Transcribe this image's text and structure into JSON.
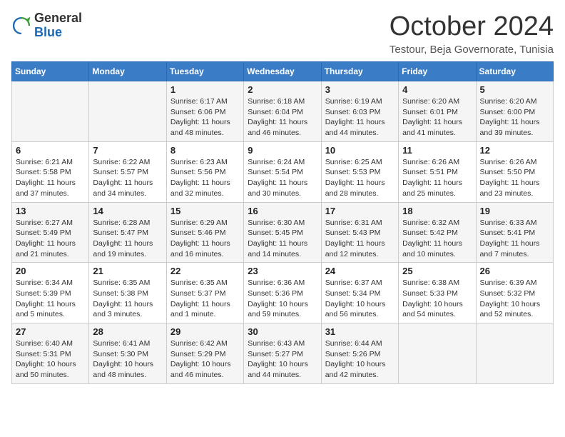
{
  "logo": {
    "general": "General",
    "blue": "Blue"
  },
  "header": {
    "month": "October 2024",
    "location": "Testour, Beja Governorate, Tunisia"
  },
  "weekdays": [
    "Sunday",
    "Monday",
    "Tuesday",
    "Wednesday",
    "Thursday",
    "Friday",
    "Saturday"
  ],
  "weeks": [
    [
      {
        "day": "",
        "info": ""
      },
      {
        "day": "",
        "info": ""
      },
      {
        "day": "1",
        "info": "Sunrise: 6:17 AM\nSunset: 6:06 PM\nDaylight: 11 hours and 48 minutes."
      },
      {
        "day": "2",
        "info": "Sunrise: 6:18 AM\nSunset: 6:04 PM\nDaylight: 11 hours and 46 minutes."
      },
      {
        "day": "3",
        "info": "Sunrise: 6:19 AM\nSunset: 6:03 PM\nDaylight: 11 hours and 44 minutes."
      },
      {
        "day": "4",
        "info": "Sunrise: 6:20 AM\nSunset: 6:01 PM\nDaylight: 11 hours and 41 minutes."
      },
      {
        "day": "5",
        "info": "Sunrise: 6:20 AM\nSunset: 6:00 PM\nDaylight: 11 hours and 39 minutes."
      }
    ],
    [
      {
        "day": "6",
        "info": "Sunrise: 6:21 AM\nSunset: 5:58 PM\nDaylight: 11 hours and 37 minutes."
      },
      {
        "day": "7",
        "info": "Sunrise: 6:22 AM\nSunset: 5:57 PM\nDaylight: 11 hours and 34 minutes."
      },
      {
        "day": "8",
        "info": "Sunrise: 6:23 AM\nSunset: 5:56 PM\nDaylight: 11 hours and 32 minutes."
      },
      {
        "day": "9",
        "info": "Sunrise: 6:24 AM\nSunset: 5:54 PM\nDaylight: 11 hours and 30 minutes."
      },
      {
        "day": "10",
        "info": "Sunrise: 6:25 AM\nSunset: 5:53 PM\nDaylight: 11 hours and 28 minutes."
      },
      {
        "day": "11",
        "info": "Sunrise: 6:26 AM\nSunset: 5:51 PM\nDaylight: 11 hours and 25 minutes."
      },
      {
        "day": "12",
        "info": "Sunrise: 6:26 AM\nSunset: 5:50 PM\nDaylight: 11 hours and 23 minutes."
      }
    ],
    [
      {
        "day": "13",
        "info": "Sunrise: 6:27 AM\nSunset: 5:49 PM\nDaylight: 11 hours and 21 minutes."
      },
      {
        "day": "14",
        "info": "Sunrise: 6:28 AM\nSunset: 5:47 PM\nDaylight: 11 hours and 19 minutes."
      },
      {
        "day": "15",
        "info": "Sunrise: 6:29 AM\nSunset: 5:46 PM\nDaylight: 11 hours and 16 minutes."
      },
      {
        "day": "16",
        "info": "Sunrise: 6:30 AM\nSunset: 5:45 PM\nDaylight: 11 hours and 14 minutes."
      },
      {
        "day": "17",
        "info": "Sunrise: 6:31 AM\nSunset: 5:43 PM\nDaylight: 11 hours and 12 minutes."
      },
      {
        "day": "18",
        "info": "Sunrise: 6:32 AM\nSunset: 5:42 PM\nDaylight: 11 hours and 10 minutes."
      },
      {
        "day": "19",
        "info": "Sunrise: 6:33 AM\nSunset: 5:41 PM\nDaylight: 11 hours and 7 minutes."
      }
    ],
    [
      {
        "day": "20",
        "info": "Sunrise: 6:34 AM\nSunset: 5:39 PM\nDaylight: 11 hours and 5 minutes."
      },
      {
        "day": "21",
        "info": "Sunrise: 6:35 AM\nSunset: 5:38 PM\nDaylight: 11 hours and 3 minutes."
      },
      {
        "day": "22",
        "info": "Sunrise: 6:35 AM\nSunset: 5:37 PM\nDaylight: 11 hours and 1 minute."
      },
      {
        "day": "23",
        "info": "Sunrise: 6:36 AM\nSunset: 5:36 PM\nDaylight: 10 hours and 59 minutes."
      },
      {
        "day": "24",
        "info": "Sunrise: 6:37 AM\nSunset: 5:34 PM\nDaylight: 10 hours and 56 minutes."
      },
      {
        "day": "25",
        "info": "Sunrise: 6:38 AM\nSunset: 5:33 PM\nDaylight: 10 hours and 54 minutes."
      },
      {
        "day": "26",
        "info": "Sunrise: 6:39 AM\nSunset: 5:32 PM\nDaylight: 10 hours and 52 minutes."
      }
    ],
    [
      {
        "day": "27",
        "info": "Sunrise: 6:40 AM\nSunset: 5:31 PM\nDaylight: 10 hours and 50 minutes."
      },
      {
        "day": "28",
        "info": "Sunrise: 6:41 AM\nSunset: 5:30 PM\nDaylight: 10 hours and 48 minutes."
      },
      {
        "day": "29",
        "info": "Sunrise: 6:42 AM\nSunset: 5:29 PM\nDaylight: 10 hours and 46 minutes."
      },
      {
        "day": "30",
        "info": "Sunrise: 6:43 AM\nSunset: 5:27 PM\nDaylight: 10 hours and 44 minutes."
      },
      {
        "day": "31",
        "info": "Sunrise: 6:44 AM\nSunset: 5:26 PM\nDaylight: 10 hours and 42 minutes."
      },
      {
        "day": "",
        "info": ""
      },
      {
        "day": "",
        "info": ""
      }
    ]
  ]
}
